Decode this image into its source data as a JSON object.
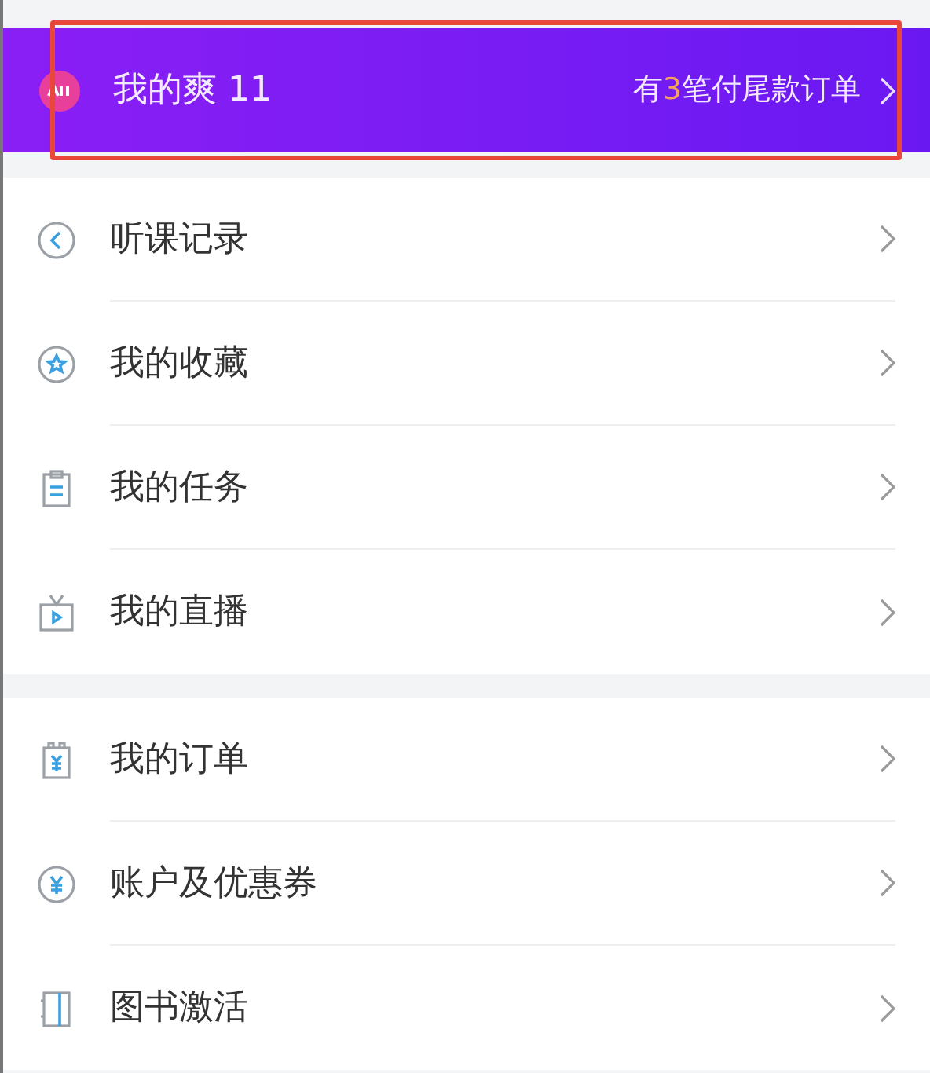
{
  "promo_banner": {
    "title": "我的爽 11",
    "notice_prefix": "有",
    "notice_count": "3",
    "notice_suffix": "笔付尾款订单",
    "highlighted": true
  },
  "sections": [
    {
      "items": [
        {
          "label": "听课记录"
        },
        {
          "label": "我的收藏"
        },
        {
          "label": "我的任务"
        },
        {
          "label": "我的直播"
        }
      ]
    },
    {
      "items": [
        {
          "label": "我的订单"
        },
        {
          "label": "账户及优惠券"
        },
        {
          "label": "图书激活"
        }
      ]
    }
  ]
}
